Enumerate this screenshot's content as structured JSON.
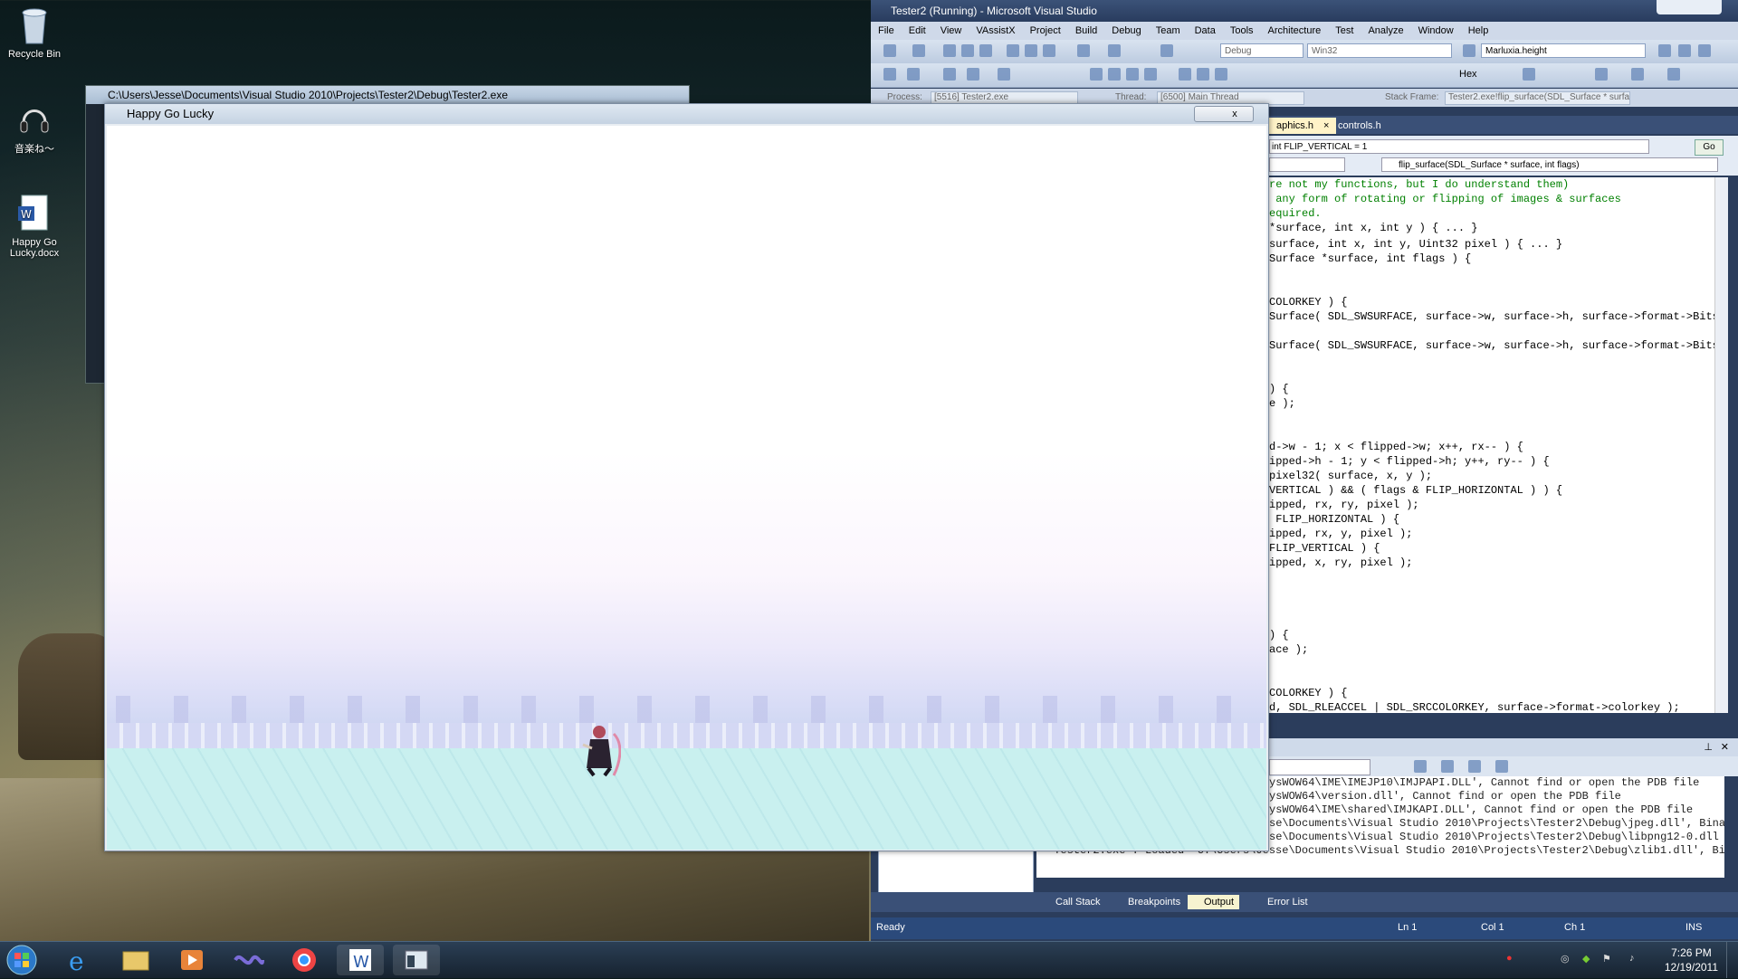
{
  "desktop": {
    "icons": [
      {
        "label": "Recycle Bin"
      },
      {
        "label": "音楽ね～"
      },
      {
        "label": "Happy Go Lucky.docx"
      }
    ]
  },
  "vs": {
    "title": "Tester2 (Running) - Microsoft Visual Studio",
    "menu": [
      "File",
      "Edit",
      "View",
      "VAssistX",
      "Project",
      "Build",
      "Debug",
      "Team",
      "Data",
      "Tools",
      "Architecture",
      "Test",
      "Analyze",
      "Window",
      "Help"
    ],
    "config": "Debug",
    "platform": "Win32",
    "find_combo": "Marluxia.height",
    "hex_label": "Hex",
    "process_label": "Process:",
    "process_value": "[5516] Tester2.exe",
    "thread_label": "Thread:",
    "thread_value": "[6500] Main Thread",
    "stack_label": "Stack Frame:",
    "stack_value": "Tester2.exe!flip_surface(SDL_Surface * surfac",
    "tabs": [
      "aphics.h",
      "controls.h"
    ],
    "nav_left": "int FLIP_VERTICAL = 1",
    "nav_go": "Go",
    "nav_right": "flip_surface(SDL_Surface * surface, int flags)",
    "code_lines": [
      "re not my functions, but I do understand them)",
      " any form of rotating or flipping of images & surfaces",
      "equired.",
      "*surface, int x, int y ) { ... }",
      "surface, int x, int y, Uint32 pixel ) { ... }",
      "Surface *surface, int flags ) {",
      "",
      "COLORKEY ) {",
      "Surface( SDL_SWSURFACE, surface->w, surface->h, surface->format->BitsPe",
      "",
      "Surface( SDL_SWSURFACE, surface->w, surface->h, surface->format->BitsPe",
      "",
      "",
      ") {",
      "e );",
      "",
      "",
      "d->w - 1; x < flipped->w; x++, rx-- ) {",
      "ipped->h - 1; y < flipped->h; y++, ry-- ) {",
      "pixel32( surface, x, y );",
      "VERTICAL ) && ( flags & FLIP_HORIZONTAL ) ) {",
      "ipped, rx, ry, pixel );",
      " FLIP_HORIZONTAL ) {",
      "ipped, rx, y, pixel );",
      "FLIP_VERTICAL ) {",
      "ipped, x, ry, pixel );",
      "",
      "",
      "",
      "",
      ") {",
      "ace );",
      "",
      "",
      "COLORKEY ) {",
      "d, SDL_RLEACCEL | SDL_SRCCOLORKEY, surface->format->colorkey );"
    ],
    "output_lines": [
      "ysWOW64\\IME\\IMEJP10\\IMJPAPI.DLL', Cannot find or open the PDB file",
      "ysWOW64\\version.dll', Cannot find or open the PDB file",
      "ysWOW64\\IME\\shared\\IMJKAPI.DLL', Cannot find or open the PDB file",
      "se\\Documents\\Visual Studio 2010\\Projects\\Tester2\\Debug\\jpeg.dll', Bina",
      "se\\Documents\\Visual Studio 2010\\Projects\\Tester2\\Debug\\libpng12-0.dll",
      "'Tester2.exe': Loaded 'C:\\Users\\Jesse\\Documents\\Visual Studio 2010\\Projects\\Tester2\\Debug\\zlib1.dll', Bin"
    ],
    "bottom_tabs": [
      "Call Stack",
      "Breakpoints",
      "Output",
      "Error List"
    ],
    "status": {
      "ready": "Ready",
      "ln": "Ln 1",
      "col": "Col 1",
      "ch": "Ch 1",
      "ins": "INS"
    }
  },
  "console": {
    "title": "C:\\Users\\Jesse\\Documents\\Visual Studio 2010\\Projects\\Tester2\\Debug\\Tester2.exe"
  },
  "game": {
    "title": "Happy Go Lucky",
    "close": "x"
  },
  "taskbar": {
    "time": "7:26 PM",
    "date": "12/19/2011"
  }
}
